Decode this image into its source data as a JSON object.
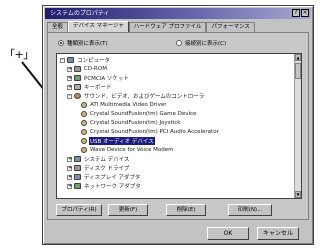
{
  "callout": {
    "text": "「+」"
  },
  "window": {
    "title": "システムのプロパティ",
    "help_btn": "?",
    "close_btn": "×"
  },
  "tabs": [
    "全般",
    "デバイス マネージャ",
    "ハードウェア プロファイル",
    "パフォーマンス"
  ],
  "view_options": {
    "by_type": "種類別に表示(T)",
    "by_connection": "接続別に表示(C)"
  },
  "tree": {
    "root": "コンピュータ",
    "items": [
      {
        "label": "CD-ROM",
        "icon": "cdrom-icon"
      },
      {
        "label": "PCMCIA ソケット",
        "icon": "pcmcia-icon"
      },
      {
        "label": "キーボード",
        "icon": "keyboard-icon"
      },
      {
        "label": "サウンド、ビデオ、およびゲームのコントローラ",
        "icon": "sound-icon"
      }
    ],
    "sound_children": [
      "ATI Multimedia Video Driver",
      "Crystal SoundFusion(tm) Game Device",
      "Crystal SoundFusion(tm) Joystick",
      "Crystal SoundFusion(tm) PCI Audio Accelerator",
      "USB オーディオ デバイス",
      "Wave Device for Voice Modem"
    ],
    "tail_items": [
      {
        "label": "システム デバイス",
        "icon": "system-icon"
      },
      {
        "label": "ディスク ドライブ",
        "icon": "disk-icon"
      },
      {
        "label": "ディスプレイ アダプタ",
        "icon": "display-icon"
      },
      {
        "label": "ネットワーク アダプタ",
        "icon": "network-icon"
      }
    ]
  },
  "panel_buttons": {
    "properties": "プロパティ(R)",
    "refresh": "更新(F)",
    "remove": "削除(E)",
    "print": "印刷(N)..."
  },
  "dialog_buttons": {
    "ok": "OK",
    "cancel": "キャンセル"
  },
  "colors": {
    "selection": "#1c1c80",
    "titlebar": "#1e1e6e"
  }
}
